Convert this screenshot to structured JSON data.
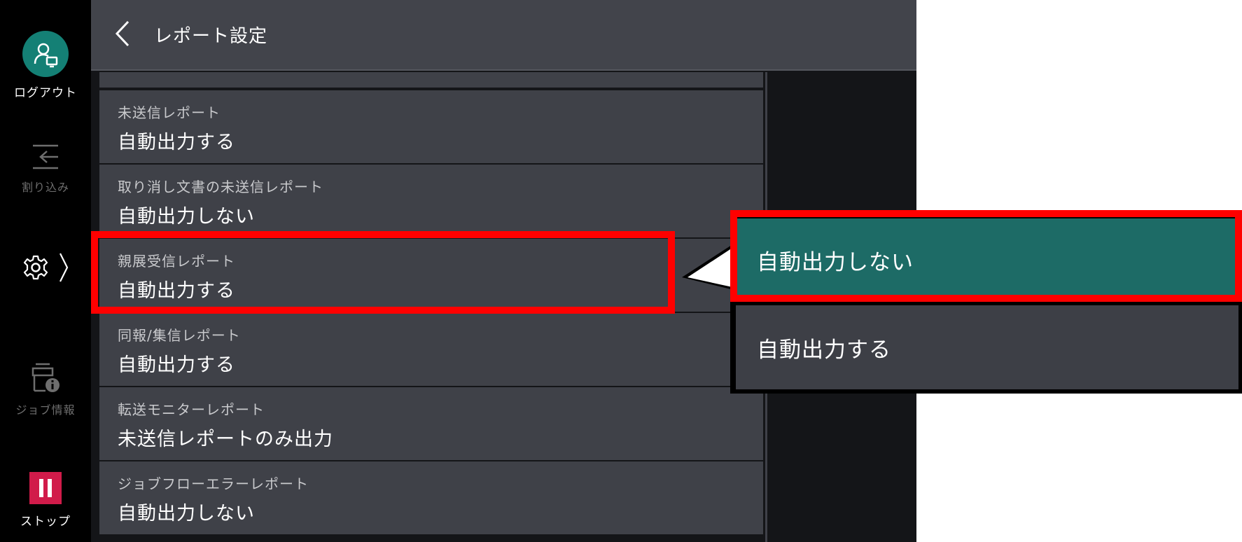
{
  "sidebar": {
    "logout_label": "ログアウト",
    "interrupt_label": "割り込み",
    "job_info_label": "ジョブ情報",
    "stop_label": "ストップ"
  },
  "header": {
    "title": "レポート設定"
  },
  "list": {
    "items": [
      {
        "label": "未送信レポート",
        "value": "自動出力する"
      },
      {
        "label": "取り消し文書の未送信レポート",
        "value": "自動出力しない"
      },
      {
        "label": "親展受信レポート",
        "value": "自動出力する"
      },
      {
        "label": "同報/集信レポート",
        "value": "自動出力する"
      },
      {
        "label": "転送モニターレポート",
        "value": "未送信レポートのみ出力"
      },
      {
        "label": "ジョブフローエラーレポート",
        "value": "自動出力しない"
      }
    ]
  },
  "dropdown": {
    "options": [
      {
        "label": "自動出力しない",
        "selected": true
      },
      {
        "label": "自動出力する",
        "selected": false
      }
    ]
  },
  "colors": {
    "accent_teal": "#148075",
    "selected_option": "#1d6b66",
    "stop_red": "#d11b4a",
    "highlight_red": "#ff0000"
  },
  "icons": [
    "person-monitor-icon",
    "interrupt-icon",
    "gear-icon",
    "chevron-right-icon",
    "job-info-icon",
    "pause-icon",
    "back-arrow-icon"
  ]
}
